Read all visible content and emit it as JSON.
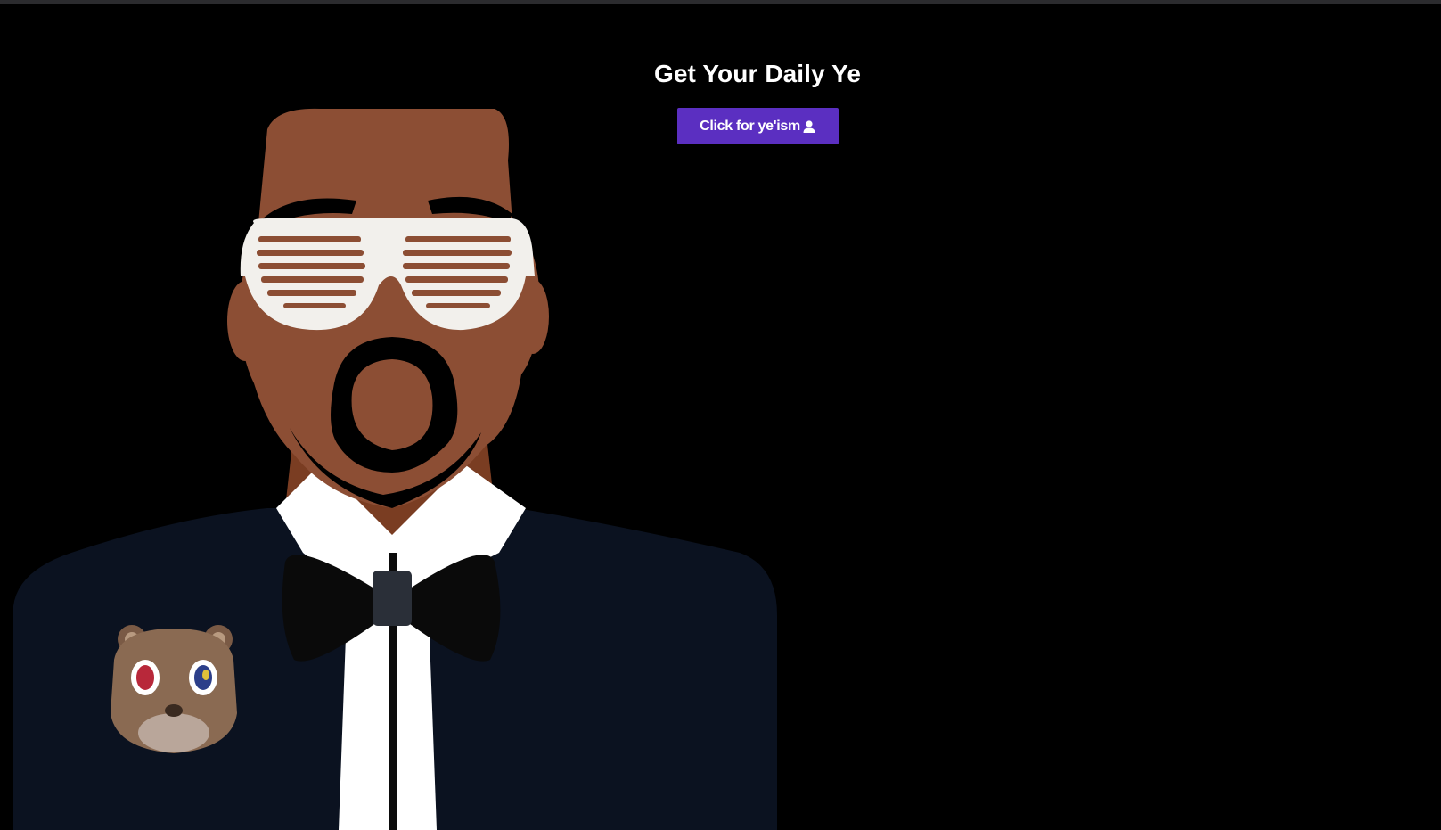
{
  "page": {
    "title": "Get Your Daily Ye",
    "background": "#000000"
  },
  "cta": {
    "label": "Click for ye'ism",
    "icon": "user-icon",
    "color": "#5b2fc1"
  },
  "illustration": {
    "subject": "cartoon-man-in-tuxedo-with-shutter-shades",
    "patch": "bear-icon"
  }
}
